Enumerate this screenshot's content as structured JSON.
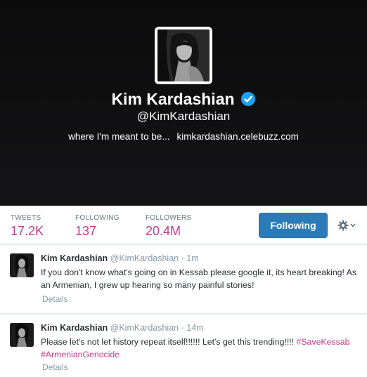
{
  "profile": {
    "name": "Kim Kardashian",
    "handle": "@KimKardashian",
    "bio": "where I'm meant to be...",
    "website": "kimkardashian.celebuzz.com",
    "verified": true
  },
  "stats": {
    "tweets_label": "TWEETS",
    "tweets_value": "17.2K",
    "following_label": "FOLLOWING",
    "following_value": "137",
    "followers_label": "FOLLOWERS",
    "followers_value": "20.4M"
  },
  "actions": {
    "follow_button": "Following",
    "settings_icon": "gear-icon"
  },
  "tweets": [
    {
      "name": "Kim Kardashian",
      "handle": "@KimKardashian",
      "time": "1m",
      "text": "If you don't know what's going on in Kessab please google it, its heart breaking! As an Armenian, I grew up hearing so many painful stories!",
      "details": "Details"
    },
    {
      "name": "Kim Kardashian",
      "handle": "@KimKardashian",
      "time": "14m",
      "text": "Please let's not let history repeat itself!!!!!! Let's get this trending!!!!",
      "hashtag_1": "#SaveKessab",
      "hashtag_2": "#ArmenianGenocide",
      "details": "Details"
    }
  ],
  "colors": {
    "accent": "#c43c89",
    "button": "#2b7bb9",
    "verified": "#1da1f2"
  }
}
